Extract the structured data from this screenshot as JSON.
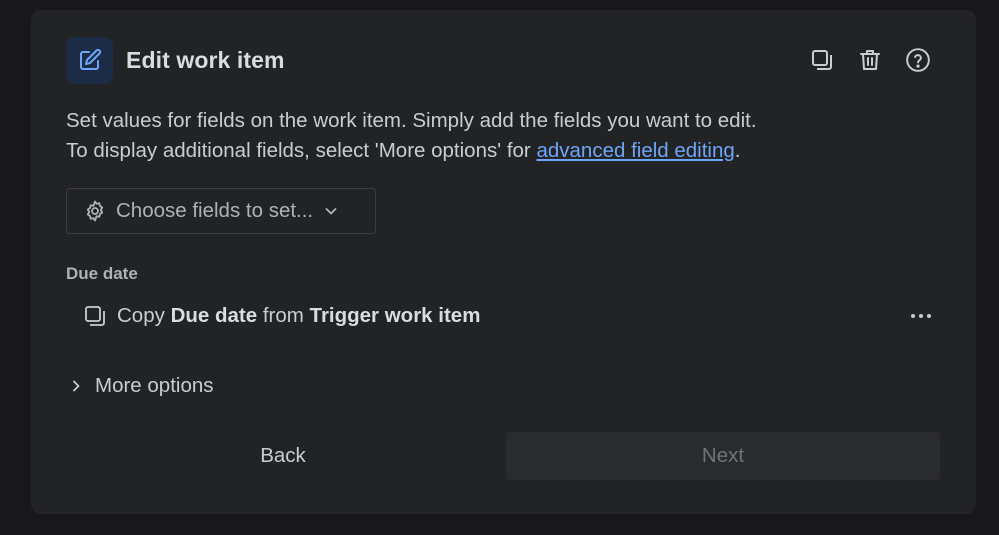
{
  "header": {
    "title": "Edit work item",
    "icon": "pencil-square-icon",
    "actions": [
      "copy-icon",
      "trash-icon",
      "help-icon"
    ]
  },
  "description": {
    "line1": "Set values for fields on the work item. Simply add the fields you want to edit.",
    "line2_prefix": "To display additional fields, select 'More options' for ",
    "link": "advanced field editing",
    "line2_suffix": "."
  },
  "choose_fields": {
    "label": "Choose fields to set...",
    "icon": "gear-icon"
  },
  "fields": [
    {
      "section_label": "Due date",
      "copy_word": "Copy",
      "field_name": "Due date",
      "from_word": "from",
      "source": "Trigger work item"
    }
  ],
  "more_options": {
    "label": "More options"
  },
  "footer": {
    "back_label": "Back",
    "next_label": "Next"
  },
  "colors": {
    "background": "#18181a",
    "panel": "#222325",
    "accent": "#6ea5f8",
    "header_icon_bg": "#1c2b46",
    "disabled_button": "#2a2b2d"
  }
}
